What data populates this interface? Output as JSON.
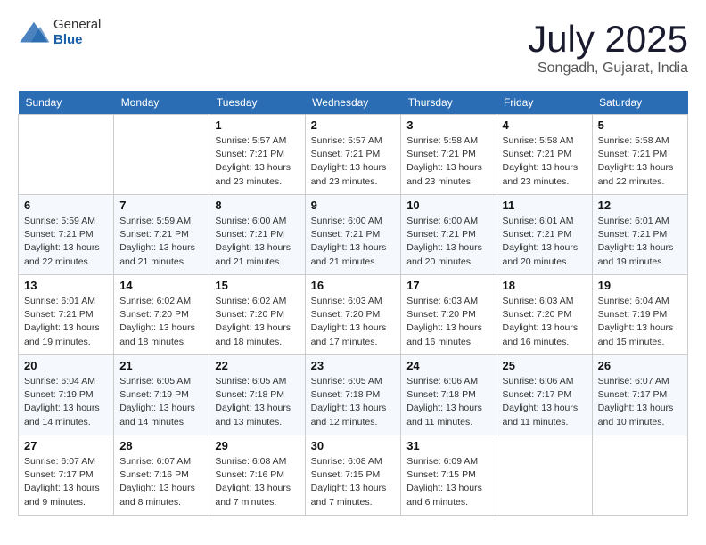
{
  "header": {
    "logo": {
      "general": "General",
      "blue": "Blue"
    },
    "title": "July 2025",
    "location": "Songadh, Gujarat, India"
  },
  "calendar": {
    "weekdays": [
      "Sunday",
      "Monday",
      "Tuesday",
      "Wednesday",
      "Thursday",
      "Friday",
      "Saturday"
    ],
    "weeks": [
      [
        {
          "day": "",
          "info": ""
        },
        {
          "day": "",
          "info": ""
        },
        {
          "day": "1",
          "info": "Sunrise: 5:57 AM\nSunset: 7:21 PM\nDaylight: 13 hours and 23 minutes."
        },
        {
          "day": "2",
          "info": "Sunrise: 5:57 AM\nSunset: 7:21 PM\nDaylight: 13 hours and 23 minutes."
        },
        {
          "day": "3",
          "info": "Sunrise: 5:58 AM\nSunset: 7:21 PM\nDaylight: 13 hours and 23 minutes."
        },
        {
          "day": "4",
          "info": "Sunrise: 5:58 AM\nSunset: 7:21 PM\nDaylight: 13 hours and 23 minutes."
        },
        {
          "day": "5",
          "info": "Sunrise: 5:58 AM\nSunset: 7:21 PM\nDaylight: 13 hours and 22 minutes."
        }
      ],
      [
        {
          "day": "6",
          "info": "Sunrise: 5:59 AM\nSunset: 7:21 PM\nDaylight: 13 hours and 22 minutes."
        },
        {
          "day": "7",
          "info": "Sunrise: 5:59 AM\nSunset: 7:21 PM\nDaylight: 13 hours and 21 minutes."
        },
        {
          "day": "8",
          "info": "Sunrise: 6:00 AM\nSunset: 7:21 PM\nDaylight: 13 hours and 21 minutes."
        },
        {
          "day": "9",
          "info": "Sunrise: 6:00 AM\nSunset: 7:21 PM\nDaylight: 13 hours and 21 minutes."
        },
        {
          "day": "10",
          "info": "Sunrise: 6:00 AM\nSunset: 7:21 PM\nDaylight: 13 hours and 20 minutes."
        },
        {
          "day": "11",
          "info": "Sunrise: 6:01 AM\nSunset: 7:21 PM\nDaylight: 13 hours and 20 minutes."
        },
        {
          "day": "12",
          "info": "Sunrise: 6:01 AM\nSunset: 7:21 PM\nDaylight: 13 hours and 19 minutes."
        }
      ],
      [
        {
          "day": "13",
          "info": "Sunrise: 6:01 AM\nSunset: 7:21 PM\nDaylight: 13 hours and 19 minutes."
        },
        {
          "day": "14",
          "info": "Sunrise: 6:02 AM\nSunset: 7:20 PM\nDaylight: 13 hours and 18 minutes."
        },
        {
          "day": "15",
          "info": "Sunrise: 6:02 AM\nSunset: 7:20 PM\nDaylight: 13 hours and 18 minutes."
        },
        {
          "day": "16",
          "info": "Sunrise: 6:03 AM\nSunset: 7:20 PM\nDaylight: 13 hours and 17 minutes."
        },
        {
          "day": "17",
          "info": "Sunrise: 6:03 AM\nSunset: 7:20 PM\nDaylight: 13 hours and 16 minutes."
        },
        {
          "day": "18",
          "info": "Sunrise: 6:03 AM\nSunset: 7:20 PM\nDaylight: 13 hours and 16 minutes."
        },
        {
          "day": "19",
          "info": "Sunrise: 6:04 AM\nSunset: 7:19 PM\nDaylight: 13 hours and 15 minutes."
        }
      ],
      [
        {
          "day": "20",
          "info": "Sunrise: 6:04 AM\nSunset: 7:19 PM\nDaylight: 13 hours and 14 minutes."
        },
        {
          "day": "21",
          "info": "Sunrise: 6:05 AM\nSunset: 7:19 PM\nDaylight: 13 hours and 14 minutes."
        },
        {
          "day": "22",
          "info": "Sunrise: 6:05 AM\nSunset: 7:18 PM\nDaylight: 13 hours and 13 minutes."
        },
        {
          "day": "23",
          "info": "Sunrise: 6:05 AM\nSunset: 7:18 PM\nDaylight: 13 hours and 12 minutes."
        },
        {
          "day": "24",
          "info": "Sunrise: 6:06 AM\nSunset: 7:18 PM\nDaylight: 13 hours and 11 minutes."
        },
        {
          "day": "25",
          "info": "Sunrise: 6:06 AM\nSunset: 7:17 PM\nDaylight: 13 hours and 11 minutes."
        },
        {
          "day": "26",
          "info": "Sunrise: 6:07 AM\nSunset: 7:17 PM\nDaylight: 13 hours and 10 minutes."
        }
      ],
      [
        {
          "day": "27",
          "info": "Sunrise: 6:07 AM\nSunset: 7:17 PM\nDaylight: 13 hours and 9 minutes."
        },
        {
          "day": "28",
          "info": "Sunrise: 6:07 AM\nSunset: 7:16 PM\nDaylight: 13 hours and 8 minutes."
        },
        {
          "day": "29",
          "info": "Sunrise: 6:08 AM\nSunset: 7:16 PM\nDaylight: 13 hours and 7 minutes."
        },
        {
          "day": "30",
          "info": "Sunrise: 6:08 AM\nSunset: 7:15 PM\nDaylight: 13 hours and 7 minutes."
        },
        {
          "day": "31",
          "info": "Sunrise: 6:09 AM\nSunset: 7:15 PM\nDaylight: 13 hours and 6 minutes."
        },
        {
          "day": "",
          "info": ""
        },
        {
          "day": "",
          "info": ""
        }
      ]
    ]
  }
}
